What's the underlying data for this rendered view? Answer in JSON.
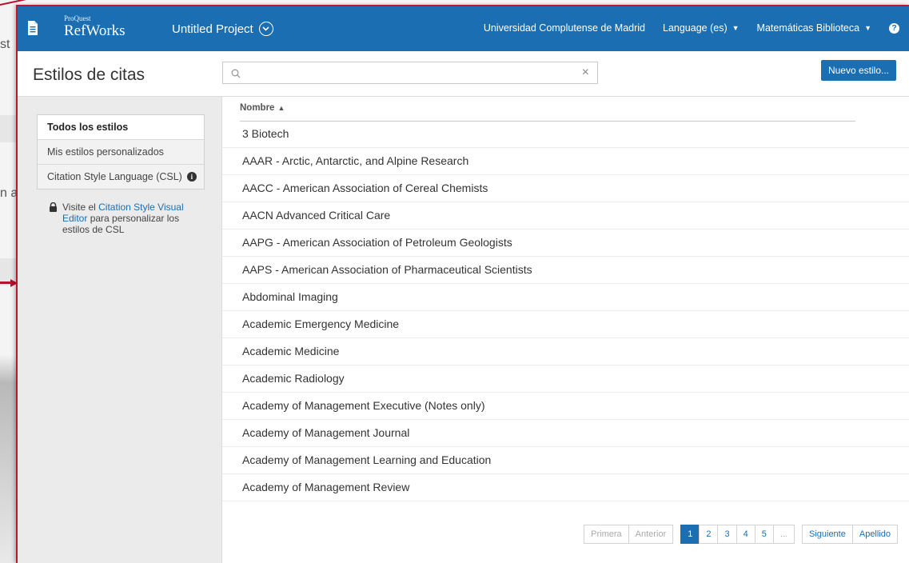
{
  "background": {
    "fragments": [
      "st",
      "n a"
    ]
  },
  "topbar": {
    "logo_small": "ProQuest",
    "logo_big": "RefWorks",
    "project_name": "Untitled Project",
    "institution": "Universidad Complutense de Madrid",
    "language": "Language (es)",
    "library": "Matemáticas Biblioteca"
  },
  "header": {
    "title": "Estilos de citas",
    "search_value": "",
    "new_style_label": "Nuevo estilo..."
  },
  "sidebar": {
    "items": [
      {
        "label": "Todos los estilos"
      },
      {
        "label": "Mis estilos personalizados"
      },
      {
        "label": "Citation Style Language (CSL)"
      }
    ],
    "note_prefix": "Visite el ",
    "note_link": "Citation Style Visual Editor",
    "note_suffix": " para personalizar los estilos de CSL"
  },
  "list": {
    "column_header": "Nombre",
    "sort_indicator": "▲",
    "rows": [
      "3 Biotech",
      "AAAR - Arctic, Antarctic, and Alpine Research",
      "AACC - American Association of Cereal Chemists",
      "AACN Advanced Critical Care",
      "AAPG - American Association of Petroleum Geologists",
      "AAPS - American Association of Pharmaceutical Scientists",
      "Abdominal Imaging",
      "Academic Emergency Medicine",
      "Academic Medicine",
      "Academic Radiology",
      "Academy of Management Executive (Notes only)",
      "Academy of Management Journal",
      "Academy of Management Learning and Education",
      "Academy of Management Review"
    ]
  },
  "pagination": {
    "first": "Primera",
    "prev": "Anterior",
    "pages": [
      "1",
      "2",
      "3",
      "4",
      "5",
      "..."
    ],
    "current": "1",
    "next": "Siguiente",
    "last": "Apellido"
  },
  "colors": {
    "accent": "#1a6eb1",
    "highlight_border": "#c0142f"
  }
}
